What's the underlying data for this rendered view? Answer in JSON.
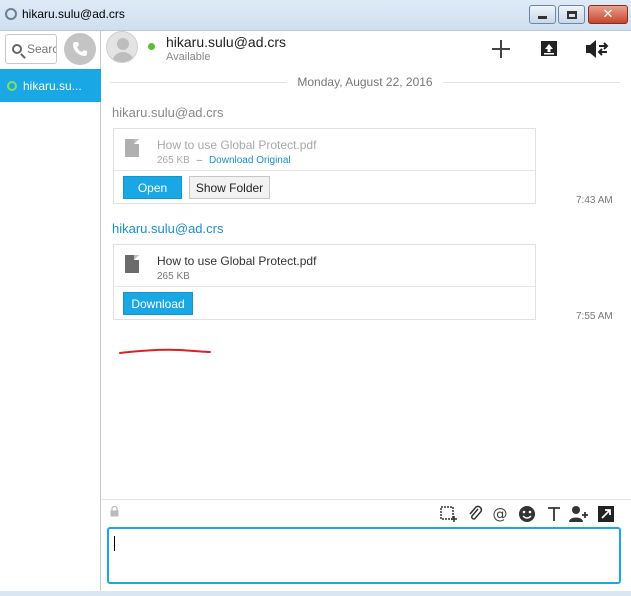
{
  "window": {
    "title": "hikaru.sulu@ad.crs",
    "controls": [
      "minimize",
      "maximize",
      "close"
    ]
  },
  "sidebar": {
    "search_placeholder": "Search",
    "contacts": [
      {
        "name": "hikaru.sulu@ad.crs",
        "display": "hikaru.su...",
        "status": "online",
        "selected": true
      }
    ]
  },
  "header": {
    "contact_name": "hikaru.sulu@ad.crs",
    "status": "Available",
    "icons": [
      "add-icon",
      "share-screen-icon",
      "call-transfer-icon"
    ]
  },
  "conversation": {
    "date": "Monday, August 22, 2016",
    "messages": [
      {
        "sender": "hikaru.sulu@ad.crs",
        "sender_style": "gray",
        "file_name": "How to use Global Protect.pdf",
        "file_size": "265 KB",
        "link_separator": "–",
        "link_label": "Download Original",
        "buttons": [
          "Open",
          "Show Folder"
        ],
        "time": "7:43 AM"
      },
      {
        "sender": "hikaru.sulu@ad.crs",
        "sender_style": "blue",
        "file_name": "How to use Global Protect.pdf",
        "file_size": "265 KB",
        "buttons": [
          "Download"
        ],
        "time": "7:55 AM"
      }
    ]
  },
  "composer": {
    "tools": [
      "screenshot-icon",
      "attach-icon",
      "mention-icon",
      "emoji-icon",
      "text-format-icon",
      "add-person-icon",
      "expand-icon"
    ],
    "input_value": ""
  },
  "colors": {
    "accent": "#1aa7e6",
    "presence": "#56c12c",
    "annotation": "#e02020"
  }
}
